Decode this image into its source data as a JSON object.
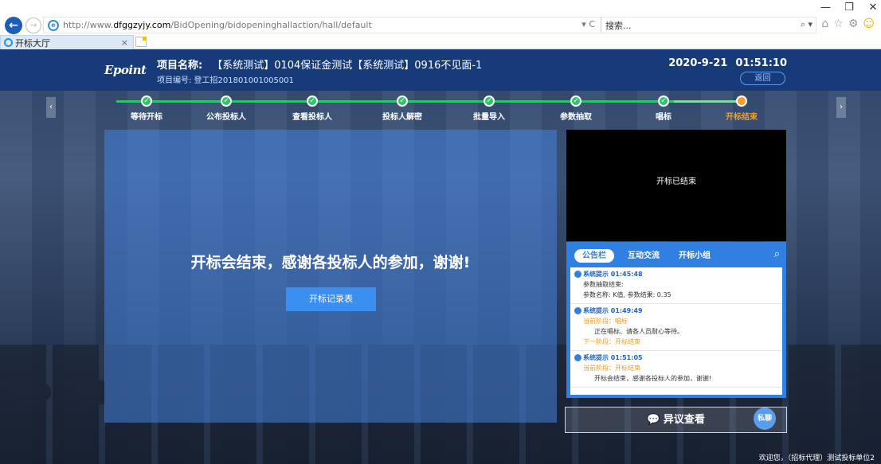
{
  "browser": {
    "window_controls": [
      "—",
      "❐",
      "✕"
    ],
    "url_prefix": "http://www.",
    "url_host": "dfggzyjy.com",
    "url_path": "/BidOpening/bidopeninghallaction/hall/default",
    "addr_controls": "▾ C",
    "search_placeholder": "搜索...",
    "search_icons": "⌕ ▾",
    "toolbar_icons": [
      "⌂",
      "☆",
      "⚙",
      "☺"
    ],
    "tab_title": "开标大厅",
    "tab_close": "×"
  },
  "header": {
    "logo": "Epoint",
    "project_label": "项目名称:",
    "project_name": "【系统测试】0104保证金测试【系统测试】0916不见面-1",
    "project_no": "项目编号: 登工招201801001005001",
    "date": "2020-9-21",
    "time": "01:51:10",
    "back_label": "返回"
  },
  "progress": {
    "arrow_left": "‹",
    "arrow_right": "›",
    "steps": [
      {
        "label": "等待开标",
        "state": "done"
      },
      {
        "label": "公布投标人",
        "state": "done"
      },
      {
        "label": "查看投标人",
        "state": "done"
      },
      {
        "label": "投标人解密",
        "state": "done"
      },
      {
        "label": "批量导入",
        "state": "done"
      },
      {
        "label": "参数抽取",
        "state": "done"
      },
      {
        "label": "唱标",
        "state": "done"
      },
      {
        "label": "开标结束",
        "state": "current"
      }
    ]
  },
  "main": {
    "message": "开标会结束，感谢各投标人的参加，谢谢!",
    "record_button": "开标记录表"
  },
  "video": {
    "status": "开标已结束"
  },
  "notice": {
    "tabs": [
      "公告栏",
      "互动交流",
      "开标小组"
    ],
    "search_icon": "⌕",
    "messages": [
      {
        "head": "系统提示 01:45:48",
        "lines": [
          "参数抽取结束:",
          "参数名称: K值, 参数结果: 0.35"
        ]
      },
      {
        "head": "系统提示 01:49:49",
        "current_stage": "当前阶段：唱标",
        "body": "正在唱标、请各人员耐心等待。",
        "next_stage": "下一阶段：开标结束"
      },
      {
        "head": "系统提示 01:51:05",
        "current_stage": "当前阶段：开标结束",
        "body": "开标会结束，感谢各投标人的参加，谢谢!"
      }
    ],
    "chat_button": "私聊"
  },
  "objection_button": "异议查看",
  "objection_icon": "💬",
  "welcome": "欢迎您，（招标代理）测试投标单位2"
}
